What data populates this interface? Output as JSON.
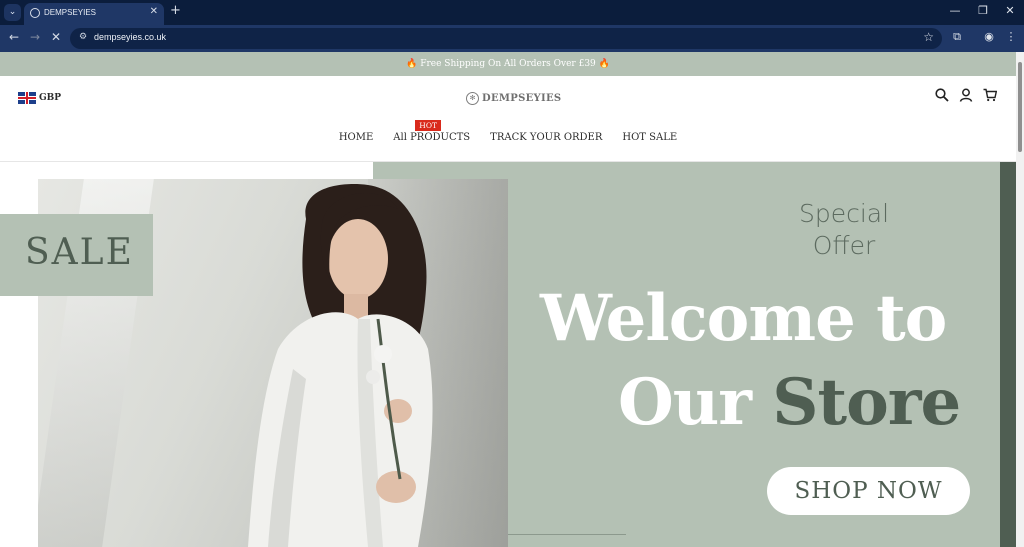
{
  "browser": {
    "tab_title": "DEMPSEYIES",
    "url": "dempseyies.co.uk",
    "tab_menu_icon": "chevron-down-icon",
    "new_tab_label": "+",
    "minimize_label": "—",
    "maximize_label": "❐",
    "close_label": "✕"
  },
  "site": {
    "announcement": "🔥 Free Shipping On All Orders Over £39 🔥",
    "currency": "GBP",
    "logo_text": "DEMPSEYIES",
    "nav": [
      {
        "label": "HOME"
      },
      {
        "label": "All PRODUCTS",
        "badge": "HOT"
      },
      {
        "label": "TRACK YOUR ORDER"
      },
      {
        "label": "HOT SALE"
      }
    ],
    "header_icons": [
      "search-icon",
      "account-icon",
      "cart-icon"
    ]
  },
  "hero": {
    "sale_label": "SALE",
    "special_line1": "Special",
    "special_line2": "Offer",
    "headline_line1": "Welcome to",
    "headline_word_our": "Our",
    "headline_word_store": "Store",
    "cta_label": "SHOP NOW"
  },
  "colors": {
    "sage": "#b4c1b4",
    "dark_green": "#4f5e52",
    "hot_badge": "#d92a1c",
    "chrome_dark": "#0b1d3c",
    "chrome_bar": "#1f3766"
  }
}
